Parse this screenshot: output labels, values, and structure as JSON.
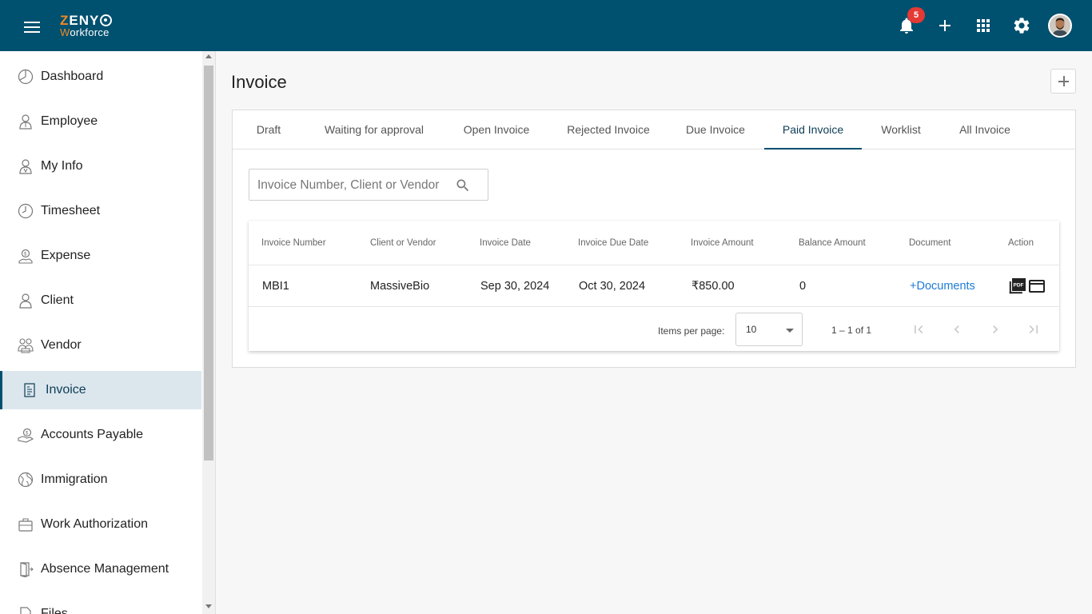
{
  "app": {
    "logo_line1_first": "Z",
    "logo_line1_rest": "ENY",
    "logo_line2_first": "W",
    "logo_line2_rest": "orkforce",
    "notification_count": "5",
    "brand_color": "#00506f",
    "accent_color": "#f08a24"
  },
  "topbar_icons": [
    "menu-icon",
    "bell-icon",
    "plus-icon",
    "apps-grid-icon",
    "gear-icon",
    "avatar"
  ],
  "sidebar": {
    "items": [
      {
        "label": "Dashboard",
        "icon": "dashboard-icon"
      },
      {
        "label": "Employee",
        "icon": "employee-icon"
      },
      {
        "label": "My Info",
        "icon": "my-info-icon"
      },
      {
        "label": "Timesheet",
        "icon": "clock-icon"
      },
      {
        "label": "Expense",
        "icon": "expense-icon"
      },
      {
        "label": "Client",
        "icon": "client-icon"
      },
      {
        "label": "Vendor",
        "icon": "vendor-icon"
      },
      {
        "label": "Invoice",
        "icon": "invoice-icon",
        "active": true
      },
      {
        "label": "Accounts Payable",
        "icon": "accounts-payable-icon"
      },
      {
        "label": "Immigration",
        "icon": "globe-icon"
      },
      {
        "label": "Work Authorization",
        "icon": "briefcase-icon"
      },
      {
        "label": "Absence Management",
        "icon": "door-icon"
      },
      {
        "label": "Files",
        "icon": "files-icon"
      }
    ]
  },
  "page": {
    "title": "Invoice"
  },
  "tabs": [
    {
      "label": "Draft"
    },
    {
      "label": "Waiting for approval"
    },
    {
      "label": "Open Invoice"
    },
    {
      "label": "Rejected Invoice"
    },
    {
      "label": "Due Invoice"
    },
    {
      "label": "Paid Invoice",
      "active": true
    },
    {
      "label": "Worklist"
    },
    {
      "label": "All Invoice"
    }
  ],
  "search": {
    "placeholder": "Invoice Number, Client or Vendor"
  },
  "table": {
    "columns": [
      "Invoice Number",
      "Client or Vendor",
      "Invoice Date",
      "Invoice Due Date",
      "Invoice Amount",
      "Balance Amount",
      "Document",
      "Action"
    ],
    "rows": [
      {
        "invoice_number": "MBI1",
        "client_or_vendor": "MassiveBio",
        "invoice_date": "Sep 30, 2024",
        "invoice_due_date": "Oct 30, 2024",
        "invoice_amount": "₹850.00",
        "balance_amount": "0",
        "document": "+Documents",
        "actions": [
          "pdf-icon",
          "card-icon"
        ]
      }
    ]
  },
  "paginator": {
    "items_per_page_label": "Items per page:",
    "page_size": "10",
    "range": "1 – 1 of 1"
  }
}
